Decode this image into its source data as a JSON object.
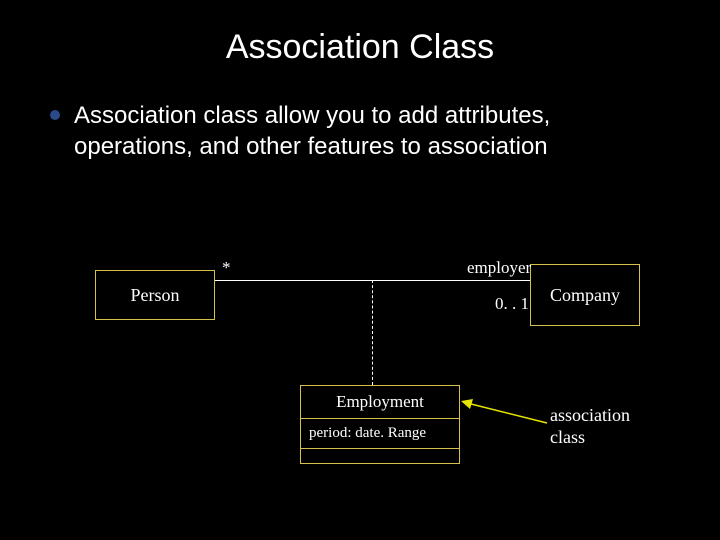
{
  "title": "Association Class",
  "bullet": "Association class allow you to add attributes, operations, and other features to association",
  "diagram": {
    "person": "Person",
    "company": "Company",
    "employment_name": "Employment",
    "employment_attr": "period: date. Range",
    "label_star": "*",
    "label_employer": "employer",
    "label_mult": "0. . 1",
    "annotation_line1": "association",
    "annotation_line2": "class"
  },
  "colors": {
    "background": "#000000",
    "box_border": "#d6c24a",
    "bullet": "#2a4a8a",
    "arrow": "#e6e600"
  }
}
